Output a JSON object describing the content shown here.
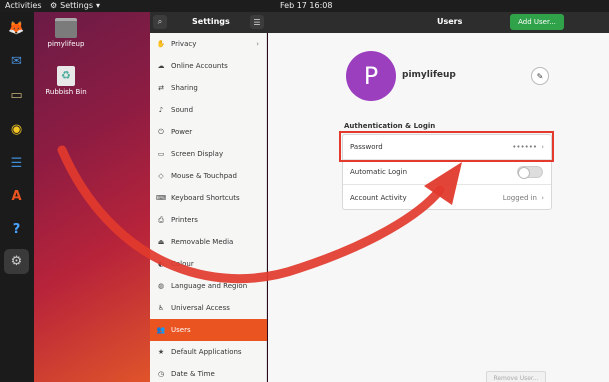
{
  "topbar": {
    "activities": "Activities",
    "app_menu": "Settings",
    "app_menu_arrow": "▾",
    "clock": "Feb 17  16:08"
  },
  "dock": {
    "items": [
      {
        "name": "firefox-icon",
        "glyph": "🦊"
      },
      {
        "name": "thunderbird-icon",
        "glyph": "✉"
      },
      {
        "name": "files-icon",
        "glyph": "▭"
      },
      {
        "name": "rhythmbox-icon",
        "glyph": "◉"
      },
      {
        "name": "writer-icon",
        "glyph": "☰"
      },
      {
        "name": "software-icon",
        "glyph": "A"
      },
      {
        "name": "help-icon",
        "glyph": "?"
      },
      {
        "name": "settings-icon",
        "glyph": "⚙"
      }
    ]
  },
  "desktop": {
    "icons": [
      {
        "label": "pimylifeup",
        "icon": "home-folder-icon"
      },
      {
        "label": "Rubbish Bin",
        "icon": "trash-icon"
      }
    ]
  },
  "settings": {
    "sidebar_title": "Settings",
    "search_glyph": "🔍",
    "menu_glyph": "☰",
    "main_title": "Users",
    "add_user": "Add User...",
    "sidebar_items": [
      {
        "label": "Privacy",
        "glyph": "✋",
        "chevron": "›"
      },
      {
        "label": "Online Accounts",
        "glyph": "☁"
      },
      {
        "label": "Sharing",
        "glyph": "⇄"
      },
      {
        "label": "Sound",
        "glyph": "♪"
      },
      {
        "label": "Power",
        "glyph": "⏻"
      },
      {
        "label": "Screen Display",
        "glyph": "▭"
      },
      {
        "label": "Mouse & Touchpad",
        "glyph": "◇"
      },
      {
        "label": "Keyboard Shortcuts",
        "glyph": "⌨"
      },
      {
        "label": "Printers",
        "glyph": "⎙"
      },
      {
        "label": "Removable Media",
        "glyph": "⏏"
      },
      {
        "label": "Colour",
        "glyph": "◐"
      },
      {
        "label": "Language and Region",
        "glyph": "◍"
      },
      {
        "label": "Universal Access",
        "glyph": "♿"
      },
      {
        "label": "Users",
        "glyph": "👥",
        "active": true
      },
      {
        "label": "Default Applications",
        "glyph": "★"
      },
      {
        "label": "Date & Time",
        "glyph": "◷"
      }
    ],
    "user": {
      "initial": "P",
      "name": "pimylifeup",
      "avatar_color": "#9b3fbf",
      "edit_glyph": "✎"
    },
    "auth_section": "Authentication & Login",
    "rows": {
      "password_label": "Password",
      "password_value": "••••••",
      "autologin_label": "Automatic Login",
      "activity_label": "Account Activity",
      "activity_value": "Logged in",
      "chevron": "›"
    },
    "remove_user": "Remove User..."
  },
  "colors": {
    "accent": "#e95420",
    "add_button": "#2fa24a",
    "annotation": "#e23a2d"
  }
}
